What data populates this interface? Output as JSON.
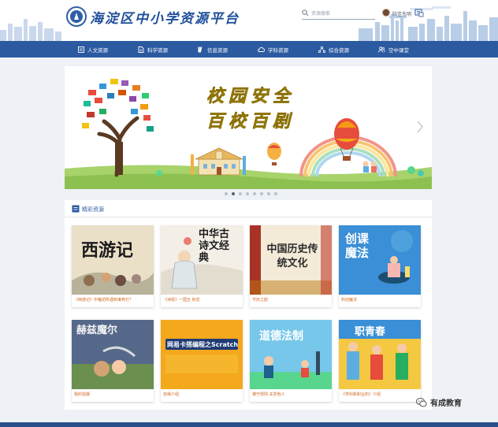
{
  "header": {
    "site_title": "海淀区中小学资源平台",
    "search_placeholder": "资源搜索",
    "username": "陆佳东明"
  },
  "nav": {
    "items": [
      {
        "label": "人文资源",
        "icon": "book-icon"
      },
      {
        "label": "科学资源",
        "icon": "document-icon"
      },
      {
        "label": "信息资源",
        "icon": "info-icon"
      },
      {
        "label": "学科资源",
        "icon": "cloud-icon"
      },
      {
        "label": "综合资源",
        "icon": "network-icon"
      },
      {
        "label": "空中课堂",
        "icon": "users-icon"
      }
    ]
  },
  "banner": {
    "title_line1": "校园安全",
    "title_line2": "百校百剧",
    "slide_count": 8,
    "active_slide": 2
  },
  "section": {
    "title": "精彩资源"
  },
  "cards": [
    {
      "label": "西游记",
      "caption": "《西游记》中猪坊所遇到谁弃灯？"
    },
    {
      "label": "中华古诗文经典",
      "caption": "《诗经》一国五 秋恋"
    },
    {
      "label": "中国历史传统文化",
      "caption": "节庆之韵"
    },
    {
      "label": "创课魔法",
      "caption": "科创魔法"
    },
    {
      "label": "赫兹魔尔",
      "caption": "我的拍摄"
    },
    {
      "label": "网易卡搭编程之Scratch",
      "caption": "自我介绍"
    },
    {
      "label": "道德法制",
      "caption": "遵守规则 关爱他人"
    },
    {
      "label": "职青春",
      "caption": "《学科新职业的》介绍"
    }
  ],
  "watermark": {
    "text": "有成教育",
    "icon": "wechat-icon"
  }
}
